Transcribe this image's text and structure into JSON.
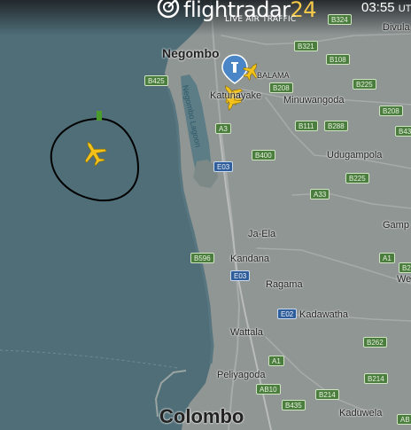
{
  "app": {
    "logo_word": "flightradar",
    "logo_number": "24",
    "logo_tagline": "LIVE AIR TRAFFIC",
    "clock": "03:55",
    "clock_tz": "UT"
  },
  "places": {
    "colombo": "Colombo",
    "negombo": "Negombo",
    "katunayake": "Katunayake",
    "kimbulapitiya": "BALAMA",
    "minuwangoda": "Minuwangoda",
    "udugampola": "Udugampola",
    "ja_ela": "Ja-Ela",
    "kandana": "Kandana",
    "ragama": "Ragama",
    "kadawatha": "Kadawatha",
    "wattala": "Wattala",
    "peliyagoda": "Peliyagoda",
    "kaduwela": "Kaduwela",
    "divulapitiya": "Divula",
    "gampaha": "Gamp",
    "weliweriya": "We",
    "negombo_lagoon": "Negombo Lagoon"
  },
  "roads": {
    "b324": "B324",
    "b321": "B321",
    "b108": "B108",
    "b425": "B425",
    "b208_a": "B208",
    "b225": "B225",
    "b208_b": "B208",
    "b111": "B111",
    "b288": "B288",
    "a3": "A3",
    "b43": "B43",
    "e03_a": "E03",
    "b400": "B400",
    "b225_b": "B225",
    "a33": "A33",
    "a1_a": "A1",
    "b2": "B2",
    "b596": "B596",
    "e03_b": "E03",
    "e02": "E02",
    "b262": "B262",
    "a1_b": "A1",
    "b214_a": "B214",
    "ab10": "AB10",
    "b214_b": "B214",
    "b435": "B435",
    "ab": "AB"
  },
  "colors": {
    "sea": "#4f6e78",
    "land": "#8f9694",
    "road_label": "#4a7d3e",
    "expressway_label": "#2f5d9a",
    "aircraft": "#f2c21b",
    "airport_pin": "#4a86c7",
    "annotation_stroke": "#000000",
    "annotation_marker": "#4a9a2c"
  },
  "icons": {
    "logo": "radar-icon",
    "airport": "airport-pin-icon",
    "aircraft": "airplane-icon"
  }
}
